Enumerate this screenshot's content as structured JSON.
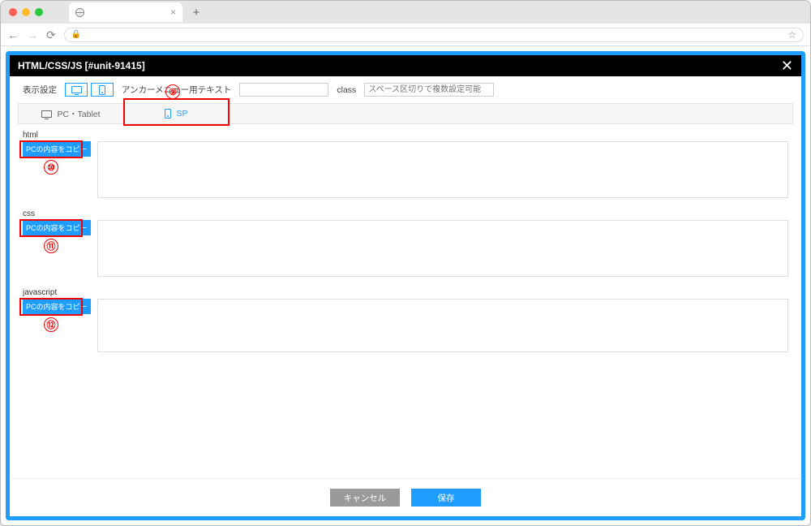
{
  "header": {
    "title": "HTML/CSS/JS [#unit-91415]"
  },
  "row1": {
    "display_label": "表示設定",
    "anchor_label": "アンカーメニュー用テキスト",
    "class_label": "class",
    "class_placeholder": "スペース区切りで複数設定可能"
  },
  "tabs": {
    "pc": "PC・Tablet",
    "sp": "SP"
  },
  "sections": [
    {
      "label": "html",
      "copy": "PCの内容をコピー",
      "ball": "⑩"
    },
    {
      "label": "css",
      "copy": "PCの内容をコピー",
      "ball": "⑪"
    },
    {
      "label": "javascript",
      "copy": "PCの内容をコピー",
      "ball": "⑫"
    }
  ],
  "footer": {
    "cancel": "キャンセル",
    "save": "保存"
  },
  "ann": {
    "sp_ball": "⑨"
  }
}
